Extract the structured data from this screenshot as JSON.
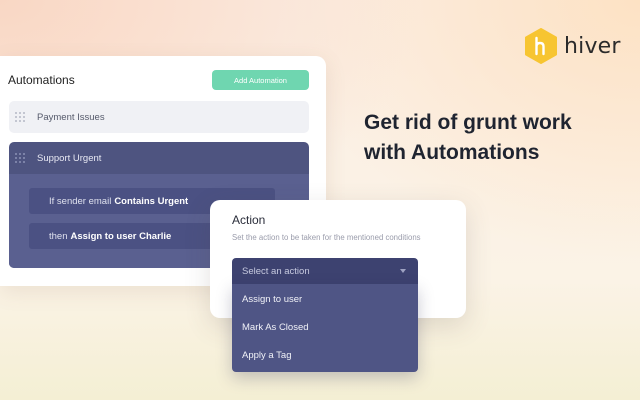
{
  "brand": {
    "name": "hiver",
    "logo_color": "#f7c531",
    "logo_mark_color": "#ffffff"
  },
  "headline": {
    "line1": "Get rid of grunt work",
    "line2": "with Automations"
  },
  "automations": {
    "title": "Automations",
    "add_button_label": "Add Automation",
    "add_button_color": "#6fd6b0",
    "rules": [
      {
        "name": "Payment Issues",
        "expanded": false
      },
      {
        "name": "Support Urgent",
        "expanded": true
      }
    ],
    "expanded_rule": {
      "condition_prefix": "If sender email",
      "condition_value": "Contains Urgent",
      "action_prefix": "then",
      "action_value": "Assign to user Charlie"
    }
  },
  "action_panel": {
    "title": "Action",
    "subtitle": "Set the action to be taken for the mentioned conditions",
    "select_placeholder": "Select an action",
    "options": [
      "Assign to user",
      "Mark As Closed",
      "Apply a Tag"
    ]
  },
  "icons": {
    "grip": "drag-grip-icon",
    "caret": "chevron-down-icon",
    "logo": "hiver-logo-icon"
  }
}
